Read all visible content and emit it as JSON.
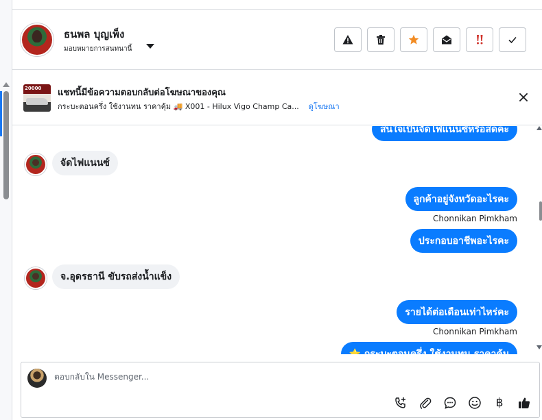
{
  "header": {
    "name": "ธนพล บุญเพ็ง",
    "assign_label": "มอบหมายการสนทนานี้",
    "buttons": {
      "report": "report-icon",
      "delete": "trash-icon",
      "star": "star-icon",
      "mark_unread": "envelope-open-icon",
      "priority": "double-exclamation-icon",
      "done": "check-icon"
    },
    "colors": {
      "star": "#f28b22",
      "priority": "#d0342c"
    }
  },
  "banner": {
    "thumbnail_text": "20000",
    "title": "แชทนี้มีข้อความตอบกลับต่อโฆษณาของคุณ",
    "ad_description": "กระบะตอนครึ่ง ใช้งานทน ราคาคุ้ม 🚚 X001 - Hilux Vigo Champ Ca...",
    "view_ad_link": "ดูโฆษณา"
  },
  "messages": [
    {
      "direction": "out",
      "text": "สนใจเป็นจัดไฟแนนซ์หรือสดคะ"
    },
    {
      "direction": "in",
      "text": "จัดไฟแนนซ์"
    },
    {
      "direction": "out",
      "text": "ลูกค้าอยู่จังหวัดอะไรคะ",
      "sender": "Chonnikan Pimkham"
    },
    {
      "direction": "out",
      "text": "ประกอบอาชีพอะไรคะ"
    },
    {
      "direction": "in",
      "text": "จ.อุดรธานี ขับรถส่งน้ำแข็ง"
    },
    {
      "direction": "out",
      "text": "รายได้ต่อเดือนเท่าไหร่คะ",
      "sender": "Chonnikan Pimkham"
    },
    {
      "direction": "out",
      "text": "⭐ กระบะตอนครึ่ง ใช้งานทน ราคาคุ้ม"
    }
  ],
  "composer": {
    "placeholder": "ตอบกลับใน Messenger...",
    "icons": [
      "phone-plus-icon",
      "paperclip-icon",
      "chat-bubble-icon",
      "emoji-icon",
      "baht-icon",
      "thumbs-up-icon"
    ],
    "baht_symbol": "฿"
  },
  "accent": "#0a7cff"
}
